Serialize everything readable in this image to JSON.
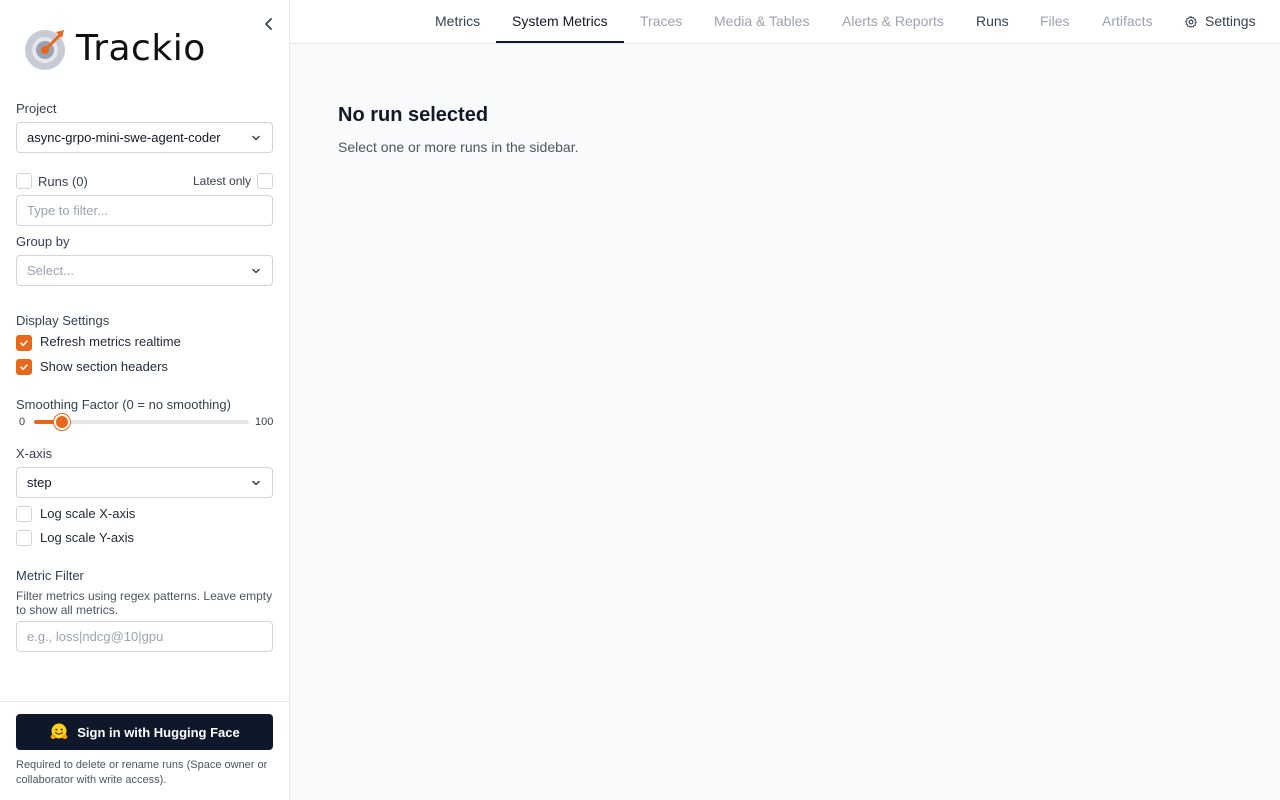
{
  "app": {
    "name": "Trackio"
  },
  "sidebar": {
    "project": {
      "label": "Project",
      "value": "async-grpo-mini-swe-agent-coder"
    },
    "runs": {
      "label": "Runs (0)",
      "latest_only_label": "Latest only",
      "filter_placeholder": "Type to filter..."
    },
    "group_by": {
      "label": "Group by",
      "placeholder": "Select..."
    },
    "display_settings": {
      "label": "Display Settings",
      "refresh_label": "Refresh metrics realtime",
      "refresh_checked": true,
      "headers_label": "Show section headers",
      "headers_checked": true
    },
    "smoothing": {
      "label": "Smoothing Factor (0 = no smoothing)",
      "min": "0",
      "max": "100",
      "value": 10
    },
    "x_axis": {
      "label": "X-axis",
      "value": "step"
    },
    "log_x": {
      "label": "Log scale X-axis",
      "checked": false
    },
    "log_y": {
      "label": "Log scale Y-axis",
      "checked": false
    },
    "metric_filter": {
      "label": "Metric Filter",
      "description": "Filter metrics using regex patterns. Leave empty to show all metrics.",
      "placeholder": "e.g., loss|ndcg@10|gpu"
    },
    "footer": {
      "signin_label": "Sign in with Hugging Face",
      "note": "Required to delete or rename runs (Space owner or collaborator with write access)."
    }
  },
  "nav": {
    "tabs": [
      {
        "label": "Metrics"
      },
      {
        "label": "System Metrics"
      },
      {
        "label": "Traces"
      },
      {
        "label": "Media & Tables"
      },
      {
        "label": "Alerts & Reports"
      },
      {
        "label": "Runs"
      },
      {
        "label": "Files"
      },
      {
        "label": "Artifacts"
      }
    ],
    "settings_label": "Settings"
  },
  "main": {
    "title": "No run selected",
    "subtitle": "Select one or more runs in the sidebar."
  },
  "colors": {
    "accent": "#e8671a",
    "dark_button": "#0f172a"
  }
}
